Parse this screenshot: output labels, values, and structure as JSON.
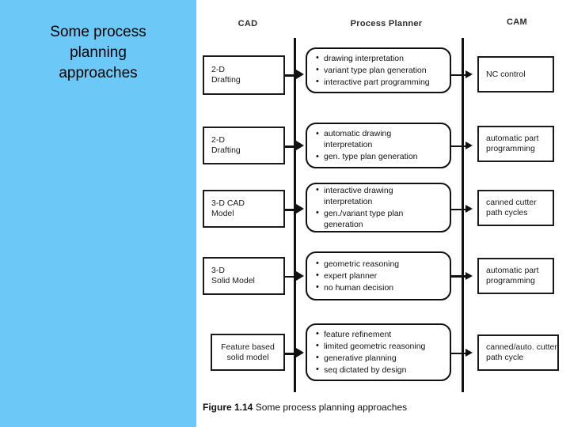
{
  "slide": {
    "title": "Some process\nplanning\napproaches",
    "panel_color": "#6cc8f7",
    "background_color": "#ffffff"
  },
  "figure": {
    "caption_number": "Figure 1.14",
    "caption_text": " Some process planning approaches",
    "columns": [
      {
        "id": "cad",
        "label": "CAD"
      },
      {
        "id": "process-planner",
        "label": "Process Planner"
      },
      {
        "id": "cam",
        "label": "CAM"
      }
    ],
    "rows": [
      {
        "cad": "2-D\nDrafting",
        "planner": [
          "drawing interpretation",
          "variant type plan generation",
          "interactive part programming"
        ],
        "cam": "NC control"
      },
      {
        "cad": "2-D\nDrafting",
        "planner": [
          "automatic drawing interpretation",
          "gen. type plan generation"
        ],
        "cam": "automatic part\nprogramming"
      },
      {
        "cad": "3-D CAD\nModel",
        "planner": [
          "interactive drawing interpretation",
          "gen./variant type plan",
          "generation"
        ],
        "cam": "canned cutter\npath cycles"
      },
      {
        "cad": "3-D\nSolid Model",
        "planner": [
          "geometric reasoning",
          "expert planner",
          "no human decision"
        ],
        "cam": "automatic part\nprogramming"
      },
      {
        "cad": "Feature based\nsolid model",
        "planner": [
          "feature refinement",
          "limited geometric reasoning",
          "generative planning",
          "seq dictated by design"
        ],
        "cam": "canned/auto. cutter\npath cycle"
      }
    ]
  }
}
